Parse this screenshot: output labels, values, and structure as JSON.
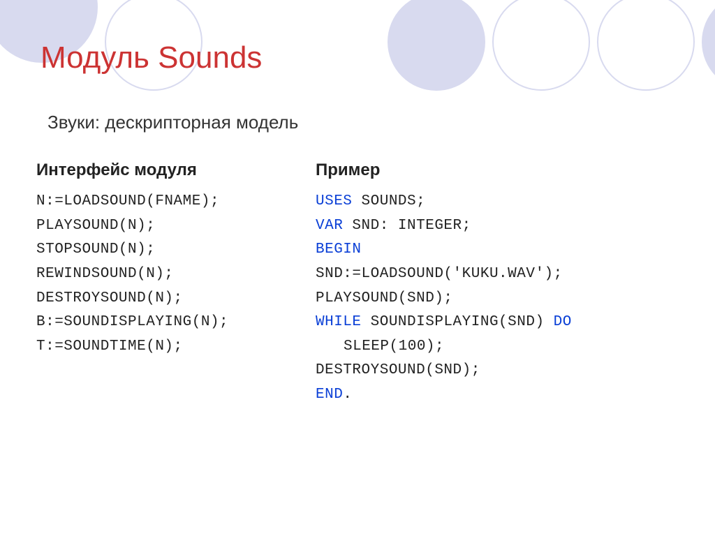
{
  "title": "Модуль Sounds",
  "subtitle": "Звуки: дескрипторная модель",
  "left": {
    "heading": "Интерфейс модуля",
    "lines": [
      "N:=LOADSOUND(FNAME);",
      "PLAYSOUND(N);",
      "STOPSOUND(N);",
      "REWINDSOUND(N);",
      "DESTROYSOUND(N);",
      "B:=SOUNDISPLAYING(N);",
      "T:=SOUNDTIME(N);"
    ]
  },
  "right": {
    "heading": "Пример",
    "lines": [
      [
        {
          "k": "USES",
          "kw": true
        },
        {
          "k": " SOUNDS;"
        }
      ],
      [
        {
          "k": "VAR",
          "kw": true
        },
        {
          "k": " SND: INTEGER;"
        }
      ],
      [
        {
          "k": "BEGIN",
          "kw": true
        }
      ],
      [
        {
          "k": "SND:=LOADSOUND('KUKU.WAV');"
        }
      ],
      [
        {
          "k": "PLAYSOUND(SND);"
        }
      ],
      [
        {
          "k": "WHILE",
          "kw": true
        },
        {
          "k": " SOUNDISPLAYING(SND) "
        },
        {
          "k": "DO",
          "kw": true
        }
      ],
      [
        {
          "k": "SLEEP(100);",
          "indent": true
        }
      ],
      [
        {
          "k": "DESTROYSOUND(SND);"
        }
      ],
      [
        {
          "k": "END",
          "kw": true
        },
        {
          "k": "."
        }
      ]
    ]
  }
}
